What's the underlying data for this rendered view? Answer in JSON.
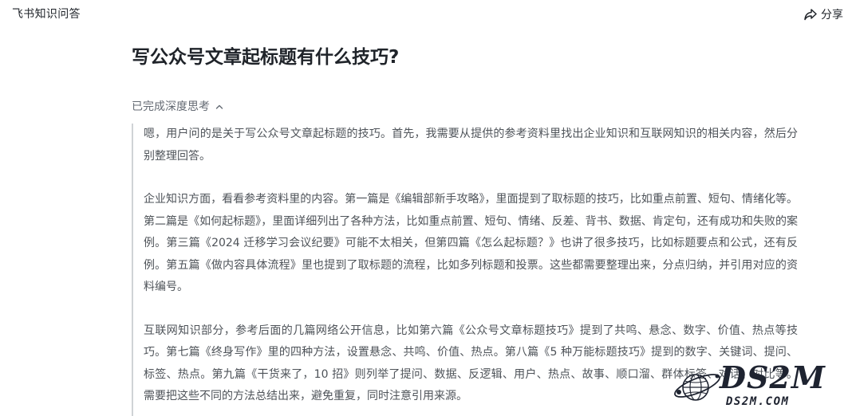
{
  "header": {
    "app_title": "飞书知识问答",
    "share_label": "分享",
    "share_icon": "share-icon"
  },
  "question": {
    "title": "写公众号文章起标题有什么技巧?"
  },
  "thinking": {
    "toggle_label": "已完成深度思考",
    "toggle_icon": "chevron-up-icon",
    "paragraphs": [
      "嗯，用户问的是关于写公众号文章起标题的技巧。首先，我需要从提供的参考资料里找出企业知识和互联网知识的相关内容，然后分别整理回答。",
      "企业知识方面，看看参考资料里的内容。第一篇是《编辑部新手攻略》，里面提到了取标题的技巧，比如重点前置、短句、情绪化等。第二篇是《如何起标题》，里面详细列出了各种方法，比如重点前置、短句、情绪、反差、背书、数据、肯定句，还有成功和失败的案例。第三篇《2024 迁移学习会议纪要》可能不太相关，但第四篇《怎么起标题？》也讲了很多技巧，比如标题要点和公式，还有反例。第五篇《做内容具体流程》里也提到了取标题的流程，比如多列标题和投票。这些都需要整理出来，分点归纳，并引用对应的资料编号。",
      "互联网知识部分，参考后面的几篇网络公开信息，比如第六篇《公众号文章标题技巧》提到了共鸣、悬念、数字、价值、热点等技巧。第七篇《终身写作》里的四种方法，设置悬念、共鸣、价值、热点。第八篇《5 种万能标题技巧》提到的数字、关键词、提问、标签、热点。第九篇《干货来了，10 招》则列举了提问、数据、反逻辑、用户、热点、故事、顺口溜、群体标签、对话、对比等。需要把这些不同的方法总结出来，避免重复，同时注意引用来源。"
    ]
  },
  "watermark": {
    "logo_text": "DS2M",
    "url_text": "DS2M.COM",
    "accent_color": "#1e2330"
  }
}
